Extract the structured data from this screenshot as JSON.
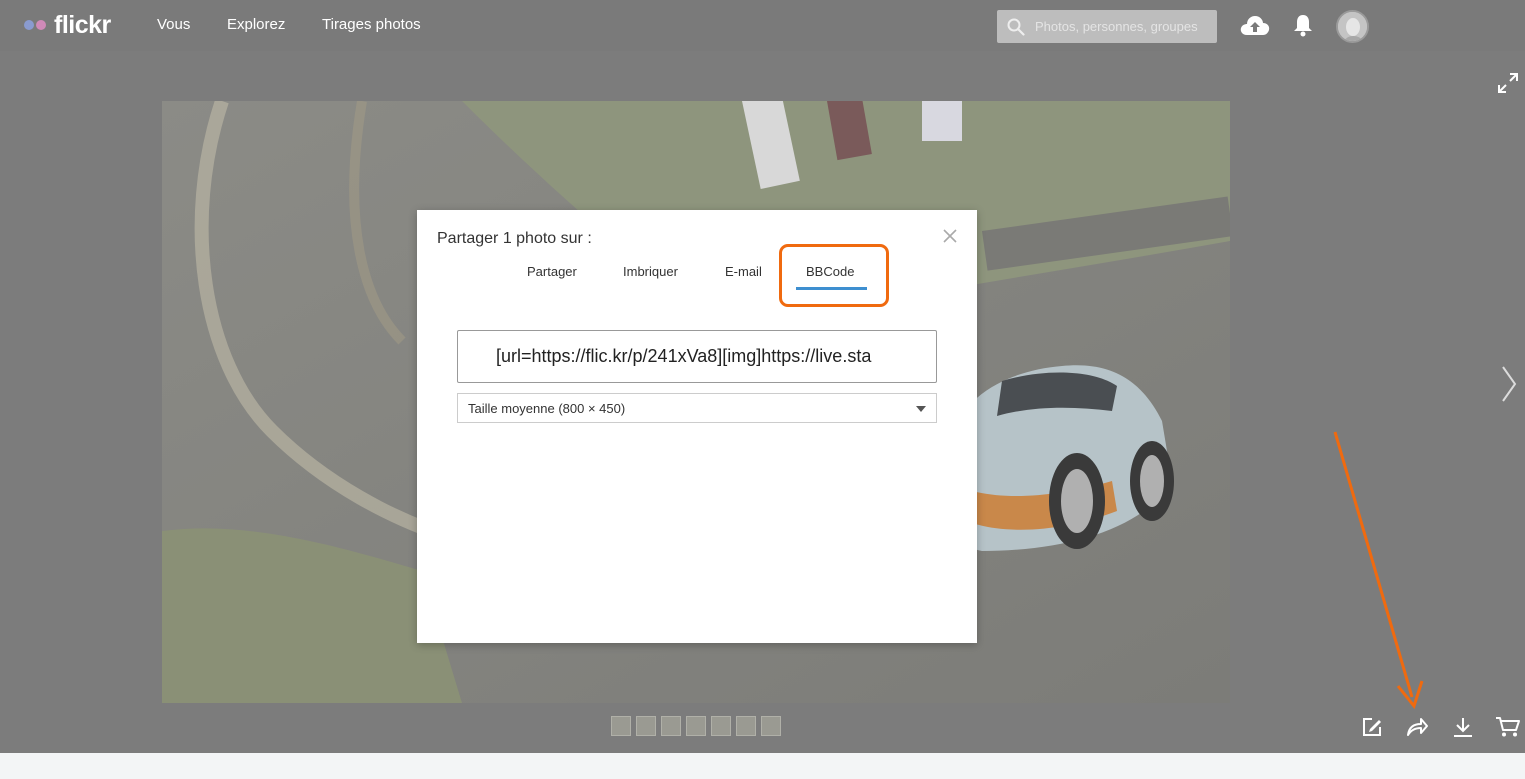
{
  "nav": {
    "logo_text": "flickr",
    "links": [
      "Vous",
      "Explorez",
      "Tirages photos"
    ],
    "search_placeholder": "Photos, personnes, groupes"
  },
  "modal": {
    "title": "Partager 1 photo sur :",
    "tabs": [
      "Partager",
      "Imbriquer",
      "E-mail",
      "BBCode"
    ],
    "active_tab": "BBCode",
    "bbcode_value": "[url=https://flic.kr/p/241xVa8][img]https://live.sta",
    "size_option": "Taille moyenne (800 × 450)"
  },
  "colors": {
    "highlight": "#f06a0f",
    "tab_underline": "#3e8fd0"
  },
  "icons": [
    "search-icon",
    "upload-cloud-icon",
    "bell-icon",
    "expand-icon",
    "next-arrow-icon",
    "close-icon",
    "edit-icon",
    "share-icon",
    "download-icon",
    "cart-icon"
  ]
}
